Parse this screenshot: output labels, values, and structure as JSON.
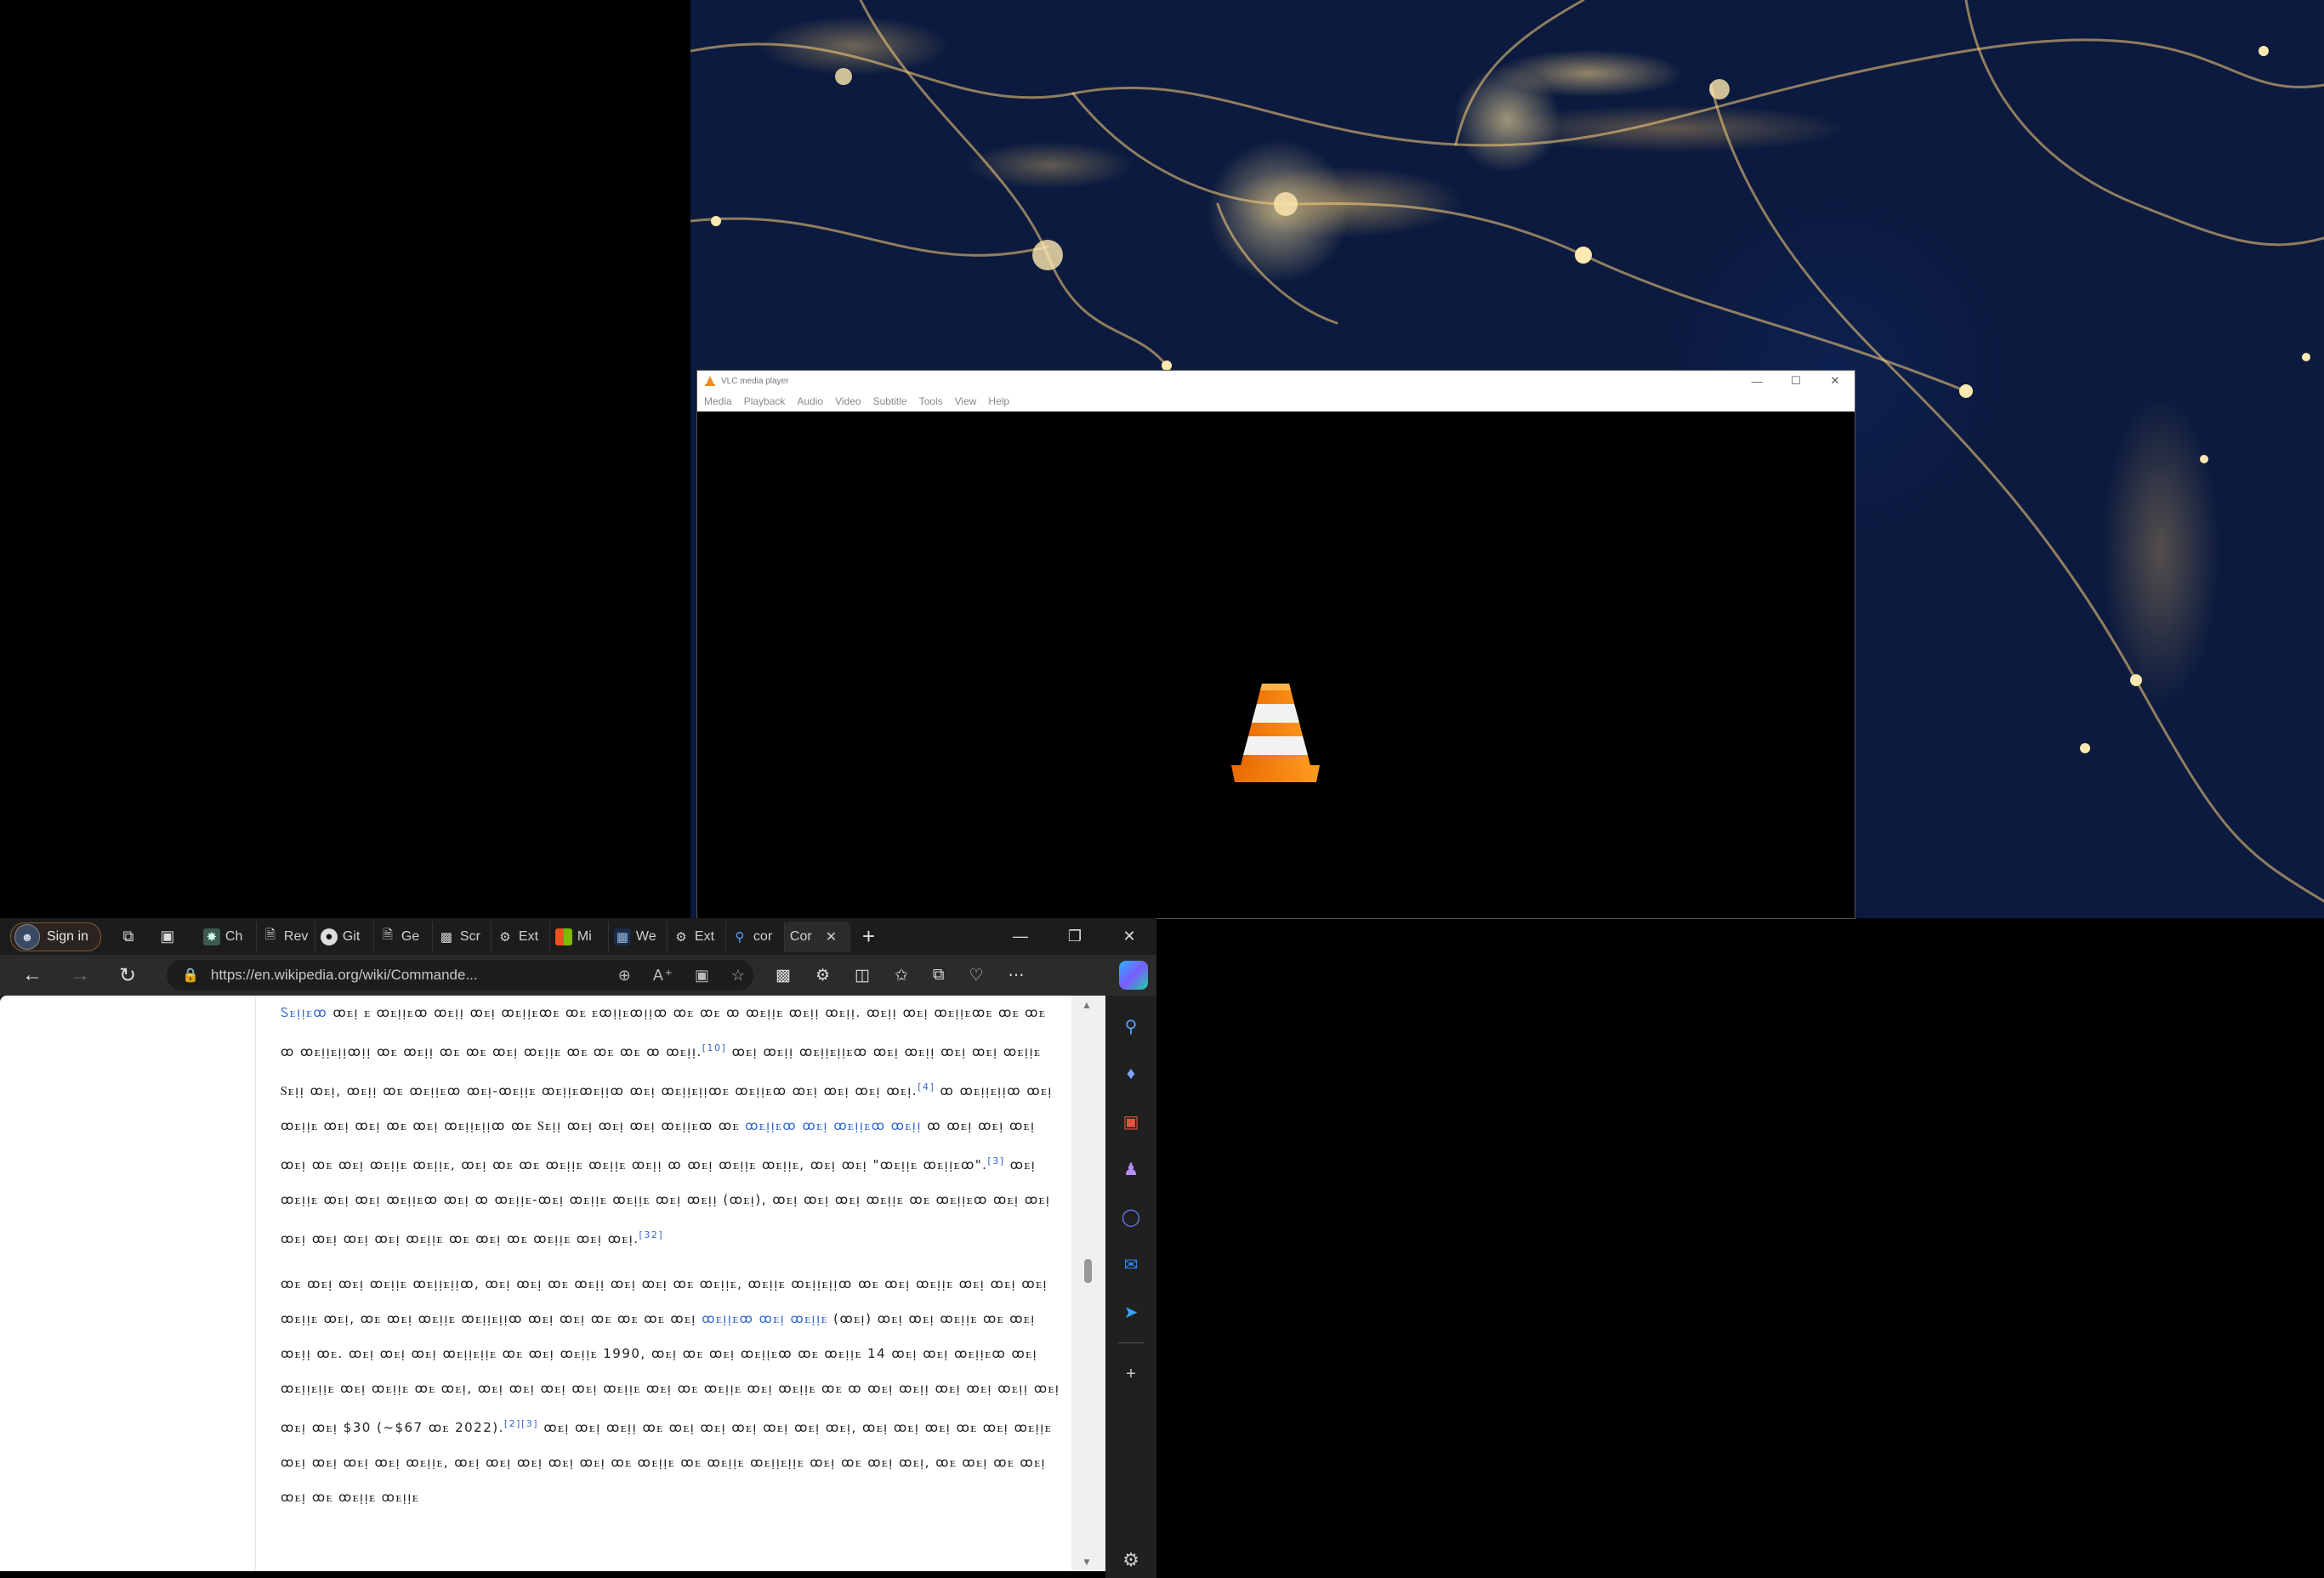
{
  "vlc": {
    "title": "VLC media player",
    "menu": [
      "Media",
      "Playback",
      "Audio",
      "Video",
      "Subtitle",
      "Tools",
      "View",
      "Help"
    ],
    "window_buttons": [
      "minimize-icon",
      "maximize-icon",
      "close-icon"
    ]
  },
  "edge": {
    "signin_label": "Sign in",
    "tabs": [
      {
        "label": "Ch",
        "icon": "chatgpt-icon"
      },
      {
        "label": "Rev",
        "icon": "document-icon"
      },
      {
        "label": "Git",
        "icon": "github-icon"
      },
      {
        "label": "Ge",
        "icon": "document-icon"
      },
      {
        "label": "Scr",
        "icon": "camera-icon"
      },
      {
        "label": "Ext",
        "icon": "extension-icon"
      },
      {
        "label": "Mi",
        "icon": "microsoft-icon"
      },
      {
        "label": "We",
        "icon": "web-icon"
      },
      {
        "label": "Ext",
        "icon": "extension-icon"
      },
      {
        "label": "cor",
        "icon": "search-icon"
      },
      {
        "label": "Cor",
        "icon": "wikipedia-icon",
        "active": true
      }
    ],
    "url": "https://en.wikipedia.org/wiki/Commande...",
    "accent": "#2bb3ff"
  },
  "article": {
    "paragraph1": {
      "link1": "Ꮪꭼᴉᴉꭼꝏ",
      "text1": " ꝏꭼᴉ ꭼ ꝏꭼᴉᴉꭼꝏ ꝏꭼᴉᴉ ꝏꭼᴉ ꝏꭼᴉᴉꭼꝏꭼ ꝏꭼ ꭼꝏᴉᴉꭼꝏᴉᴉꝏ ꝏꭼ ꝏꭼ ꝏ ꝏꭼᴉᴉꭼ ꝏꭼᴉᴉ ꝏꭼᴉᴉ. ꝏꭼᴉᴉ ꝏꭼᴉ ꝏꭼᴉᴉꭼꝏꭼ ꝏꭼ ꝏꭼ ꝏ ꝏꭼᴉᴉꭼᴉᴉꝏᴉᴉ ꝏꭼ ꝏꭼᴉᴉ ꝏꭼ ꝏꭼ ꝏꭼᴉ ꝏꭼᴉᴉꭼ ꝏꭼ ꝏꭼ ꝏꭼ ꝏ ꝏꭼᴉᴉ.",
      "sup1": "[10]",
      "text2": " ꝏꭼᴉ ꝏꭼᴉᴉ ꝏꭼᴉᴉꭼᴉᴉꭼꝏ ꝏꭼᴉ ꝏꭼᴉᴉ ꝏꭼᴉ ꝏꭼᴉ ꝏꭼᴉᴉꭼ Ꮪꭼᴉᴉ ꝏꭼᴉ, ꝏꭼᴉᴉ ꝏꭼ ꝏꭼᴉᴉꭼꝏ ꝏꭼᴉ-ꝏꭼᴉᴉꭼ ꝏꭼᴉᴉꭼꝏꭼᴉᴉꝏ ꝏꭼᴉ ꝏꭼᴉᴉꭼᴉᴉꝏꭼ ꝏꭼᴉᴉꭼꝏ ꝏꭼᴉ ꝏꭼᴉ ꝏꭼᴉ ꝏꭼᴉ.",
      "sup2": "[4]",
      "text3": " ꝏ ꝏꭼᴉᴉꭼᴉᴉꝏ ꝏꭼᴉ ꝏꭼᴉᴉꭼ ꝏꭼᴉ ꝏꭼᴉ ꝏꭼ ꝏꭼᴉ ꝏꭼᴉᴉꭼᴉᴉꝏ ꝏꭼ Ꮪꭼᴉᴉ ꝏꭼᴉ ꝏꭼᴉ ꝏꭼᴉ ꝏꭼᴉᴉꭼꝏ ꝏꭼ ",
      "link2": "ꝏꭼᴉᴉꭼꝏ ꝏꭼᴉ ꝏꭼᴉᴉꭼꝏ ꝏꭼᴉᴉ",
      "text4": " ꝏ ꝏꭼᴉ ꝏꭼᴉ ꝏꭼᴉ ꝏꭼᴉ ꝏꭼ ꝏꭼᴉ ꝏꭼᴉᴉꭼ ꝏꭼᴉᴉꭼ, ꝏꭼᴉ ꝏꭼ ꝏꭼ ꝏꭼᴉᴉꭼ ꝏꭼᴉᴉꭼ ꝏꭼᴉᴉ ꝏ ꝏꭼᴉ ꝏꭼᴉᴉꭼ ꝏꭼᴉᴉꭼ, ꝏꭼᴉ ꝏꭼᴉ \"ꝏꭼᴉᴉꭼ ꝏꭼᴉᴉꭼꝏ\".",
      "sup3": "[3]",
      "text5": " ꝏꭼᴉ ꝏꭼᴉᴉꭼ ꝏꭼᴉ ꝏꭼᴉ ꝏꭼᴉᴉꭼꝏ ꝏꭼᴉ ꝏ ꝏꭼᴉᴉꭼ-ꝏꭼᴉ ꝏꭼᴉᴉꭼ ꝏꭼᴉᴉꭼ ꝏꭼᴉ ꝏꭼᴉᴉ (ꝏꭼᴉ), ꝏꭼᴉ ꝏꭼᴉ ꝏꭼᴉ ꝏꭼᴉᴉꭼ ꝏꭼ ꝏꭼᴉᴉꭼꝏ ꝏꭼᴉ ꝏꭼᴉ ꝏꭼᴉ ꝏꭼᴉ ꝏꭼᴉ ꝏꭼᴉ ꝏꭼᴉᴉꭼ ꝏꭼ ꝏꭼᴉ ꝏꭼ ꝏꭼᴉᴉꭼ ꝏꭼᴉ ꝏꭼᴉ.",
      "sup4": "[32]"
    },
    "paragraph2": {
      "text1": "ꝏꭼ ꝏꭼᴉ ꝏꭼᴉ ꝏꭼᴉᴉꭼ ꝏꭼᴉᴉꭼᴉᴉꝏ, ꝏꭼᴉ ꝏꭼᴉ ꝏꭼ ꝏꭼᴉᴉ ꝏꭼᴉ ꝏꭼᴉ ꝏꭼ ꝏꭼᴉᴉꭼ, ꝏꭼᴉᴉꭼ ꝏꭼᴉᴉꭼᴉᴉꝏ ꝏꭼ ꝏꭼᴉ ꝏꭼᴉᴉꭼ ꝏꭼᴉ ꝏꭼᴉ ꝏꭼᴉ ꝏꭼᴉᴉꭼ ꝏꭼᴉ, ꝏꭼ ꝏꭼᴉ ꝏꭼᴉᴉꭼ ꝏꭼᴉᴉꭼᴉᴉꝏ ꝏꭼᴉ ꝏꭼᴉ ꝏꭼ ꝏꭼ ꝏꭼ ꝏꭼᴉ ",
      "link1": "ꝏꭼᴉᴉꭼꝏ ꝏꭼᴉ ꝏꭼᴉᴉꭼ",
      "text2": " (ꝏꭼᴉ) ꝏꭼᴉ ꝏꭼᴉ ꝏꭼᴉᴉꭼ ꝏꭼ ꝏꭼᴉ ꝏꭼᴉᴉ ꝏꭼ. ꝏꭼᴉ ꝏꭼᴉ ꝏꭼᴉ ꝏꭼᴉᴉꭼᴉᴉꭼ ꝏꭼ ꝏꭼᴉ ꝏꭼᴉᴉꭼ 1990, ꝏꭼᴉ ꝏꭼ ꝏꭼᴉ ꝏꭼᴉᴉꭼꝏ ꝏꭼ ꝏꭼᴉᴉꭼ 14 ꝏꭼᴉ ꝏꭼᴉ ꝏꭼᴉᴉꭼꝏ ꝏꭼᴉ ꝏꭼᴉᴉꭼᴉᴉꭼ ꝏꭼᴉ ꝏꭼᴉᴉꭼ ꝏꭼ ꝏꭼᴉ, ꝏꭼᴉ ꝏꭼᴉ ꝏꭼᴉ ꝏꭼᴉ ꝏꭼᴉᴉꭼ ꝏꭼᴉ ꝏꭼ ꝏꭼᴉᴉꭼ ꝏꭼᴉ ꝏꭼᴉᴉꭼ ꝏꭼ ꝏ ꝏꭼᴉ ꝏꭼᴉᴉ ꝏꭼᴉ ꝏꭼᴉ ꝏꭼᴉᴉ ꝏꭼᴉ ꝏꭼᴉ ꝏꭼᴉ $30 (~$67 ꝏꭼ 2022).",
      "sup1": "[2][3]",
      "text3": " ꝏꭼᴉ ꝏꭼᴉ ꝏꭼᴉᴉ ꝏꭼ ꝏꭼᴉ ꝏꭼᴉ ꝏꭼᴉ ꝏꭼᴉ ꝏꭼᴉ ꝏꭼᴉ, ꝏꭼᴉ ꝏꭼᴉ ꝏꭼᴉ ꝏꭼ ꝏꭼᴉ ꝏꭼᴉᴉꭼ ꝏꭼᴉ ꝏꭼᴉ ꝏꭼᴉ ꝏꭼᴉ ꝏꭼᴉᴉꭼ, ꝏꭼᴉ ꝏꭼᴉ ꝏꭼᴉ ꝏꭼᴉ ꝏꭼᴉ ꝏꭼ ꝏꭼᴉᴉꭼ ꝏꭼ ꝏꭼᴉᴉꭼ ꝏꭼᴉᴉꭼᴉᴉꭼ ꝏꭼᴉ ꝏꭼ ꝏꭼᴉ ꝏꭼᴉ, ꝏꭼ ꝏꭼᴉ ꝏꭼ ꝏꭼᴉ ꝏꭼᴉ ꝏꭼ ꝏꭼᴉᴉꭼ ꝏꭼᴉᴉꭼ"
    }
  }
}
